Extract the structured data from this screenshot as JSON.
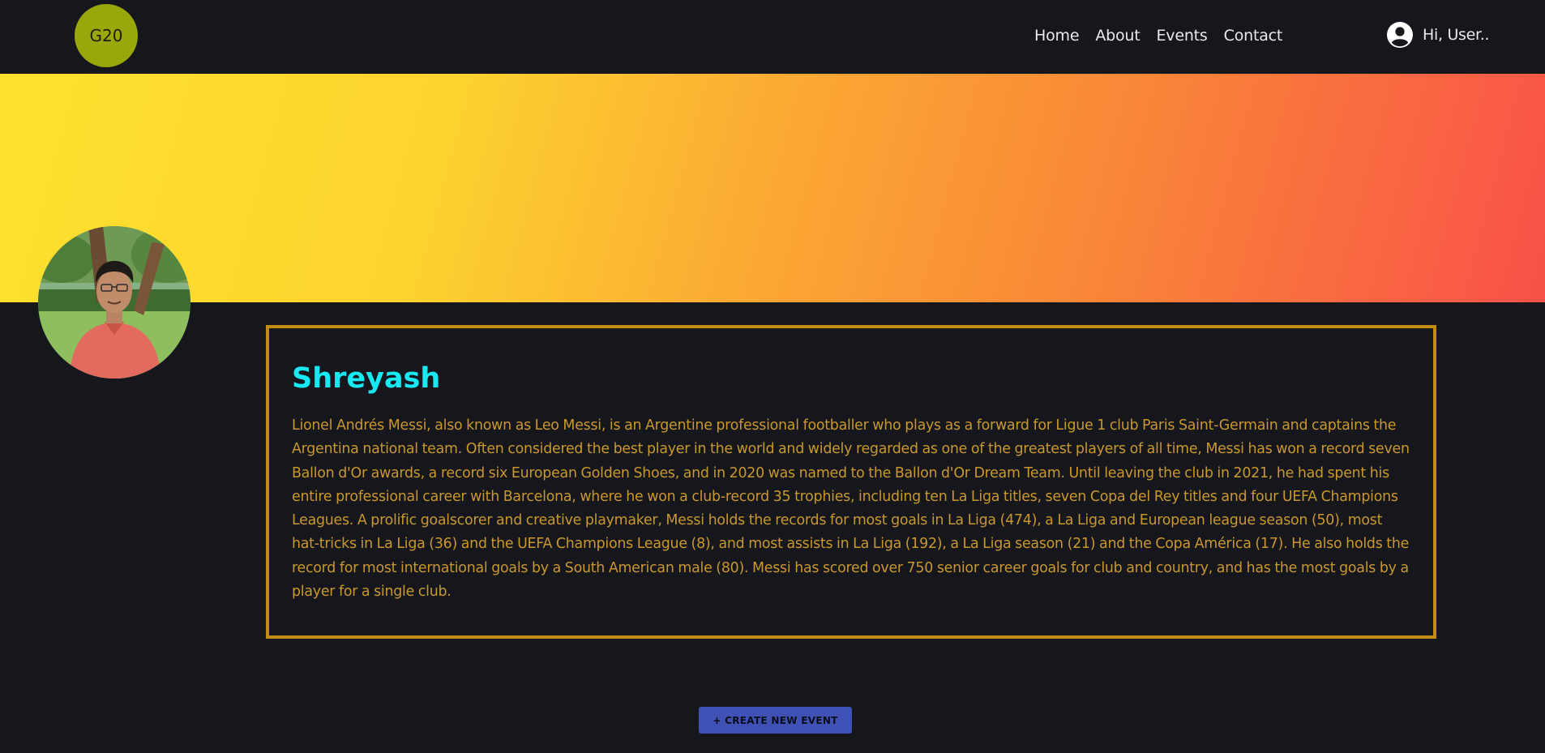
{
  "navbar": {
    "logo_text": "G20",
    "links": [
      "Home",
      "About",
      "Events",
      "Contact"
    ],
    "user_greeting": "Hi, User.."
  },
  "profile": {
    "name": "Shreyash",
    "bio": "Lionel Andrés Messi, also known as Leo Messi, is an Argentine professional footballer who plays as a forward for Ligue 1 club Paris Saint-Germain and captains the Argentina national team. Often considered the best player in the world and widely regarded as one of the greatest players of all time, Messi has won a record seven Ballon d'Or awards, a record six European Golden Shoes, and in 2020 was named to the Ballon d'Or Dream Team. Until leaving the club in 2021, he had spent his entire professional career with Barcelona, where he won a club-record 35 trophies, including ten La Liga titles, seven Copa del Rey titles and four UEFA Champions Leagues. A prolific goalscorer and creative playmaker, Messi holds the records for most goals in La Liga (474), a La Liga and European league season (50), most hat-tricks in La Liga (36) and the UEFA Champions League (8), and most assists in La Liga (192), a La Liga season (21) and the Copa América (17). He also holds the record for most international goals by a South American male (80). Messi has scored over 750 senior career goals for club and country, and has the most goals by a player for a single club."
  },
  "actions": {
    "create_event_label": "+ CREATE NEW EVENT"
  },
  "colors": {
    "background": "#16171d",
    "logo": "#98a80a",
    "name": "#18e8f2",
    "bio_text": "#c9972c",
    "card_border": "#c38a14",
    "button": "#4051b6",
    "banner_start": "#fde12d",
    "banner_end": "#f95149"
  },
  "icons": {
    "user": "account-circle-icon"
  }
}
